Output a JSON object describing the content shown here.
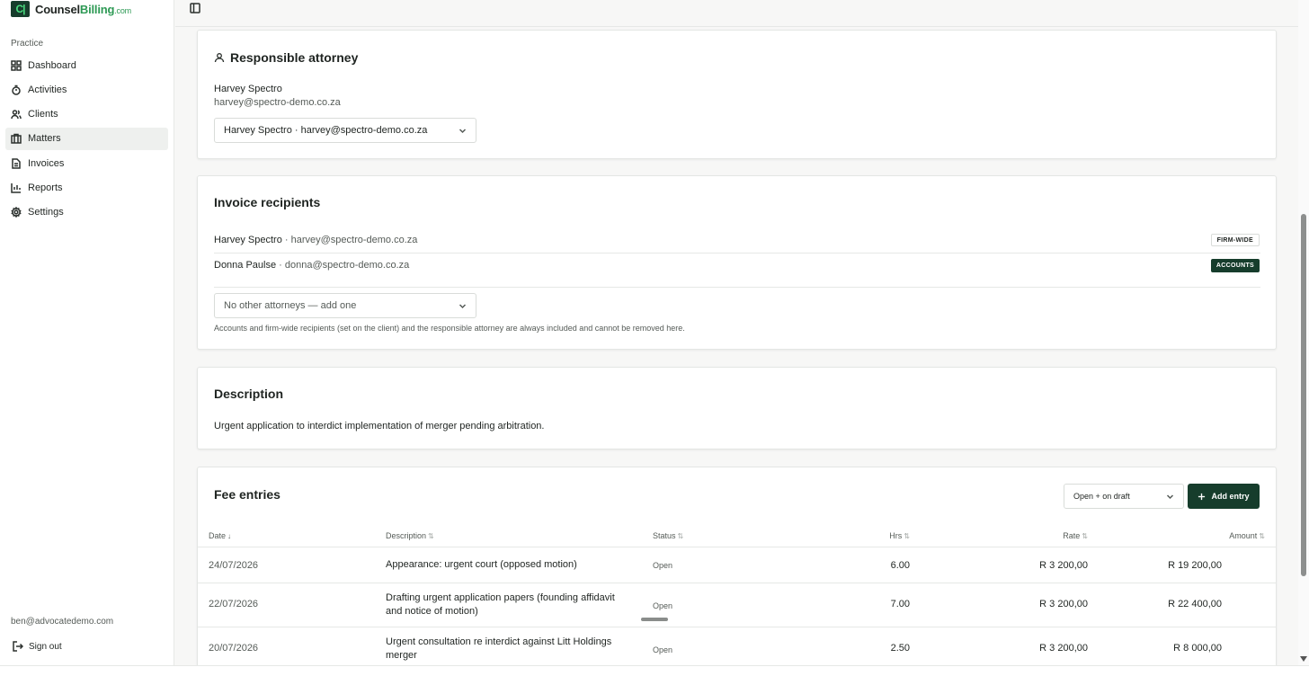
{
  "brand": {
    "logo_mark": "C|",
    "name_part1": "Counsel",
    "name_part2": "Billing",
    "name_part3": ".com"
  },
  "sidebar": {
    "section_label": "Practice",
    "items": [
      {
        "label": "Dashboard",
        "icon": "grid-icon"
      },
      {
        "label": "Activities",
        "icon": "timer-icon"
      },
      {
        "label": "Clients",
        "icon": "users-icon"
      },
      {
        "label": "Matters",
        "icon": "briefcase-icon",
        "active": true
      },
      {
        "label": "Invoices",
        "icon": "file-icon"
      },
      {
        "label": "Reports",
        "icon": "bar-chart-icon"
      },
      {
        "label": "Settings",
        "icon": "gear-icon"
      }
    ],
    "user_email": "ben@advocatedemo.com",
    "sign_out": "Sign out"
  },
  "responsible_attorney": {
    "title": "Responsible attorney",
    "name": "Harvey Spectro",
    "email": "harvey@spectro-demo.co.za",
    "select_value": "Harvey Spectro · harvey@spectro-demo.co.za"
  },
  "invoice_recipients": {
    "title": "Invoice recipients",
    "recipients": [
      {
        "name": "Harvey Spectro",
        "sep": " · ",
        "email": "harvey@spectro-demo.co.za",
        "badge": "FIRM-WIDE"
      },
      {
        "name": "Donna Paulse",
        "sep": " · ",
        "email": "donna@spectro-demo.co.za",
        "badge": "ACCOUNTS"
      }
    ],
    "select_placeholder": "No other attorneys — add one",
    "note": "Accounts and firm-wide recipients (set on the client) and the responsible attorney are always included and cannot be removed here."
  },
  "description": {
    "title": "Description",
    "text": "Urgent application to interdict implementation of merger pending arbitration."
  },
  "fee_entries": {
    "title": "Fee entries",
    "filter_value": "Open + on draft",
    "add_label": "Add entry",
    "columns": {
      "date": "Date",
      "description": "Description",
      "status": "Status",
      "hrs": "Hrs",
      "rate": "Rate",
      "amount": "Amount"
    },
    "sort_desc_glyph": "↓",
    "sort_glyph": "⇅",
    "rows": [
      {
        "date": "24/07/2026",
        "description_1": "Appearance: urgent court (opposed motion)",
        "description_2": "",
        "status": "Open",
        "hrs": "6.00",
        "rate": "R 3 200,00",
        "amount": "R 19 200,00"
      },
      {
        "date": "22/07/2026",
        "description_1": "Drafting urgent application papers (founding affidavit",
        "description_2": "and notice of motion)",
        "status": "Open",
        "hrs": "7.00",
        "rate": "R 3 200,00",
        "amount": "R 22 400,00"
      },
      {
        "date": "20/07/2026",
        "description_1": "Urgent consultation re interdict against Litt Holdings",
        "description_2": "merger",
        "status": "Open",
        "hrs": "2.50",
        "rate": "R 3 200,00",
        "amount": "R 8 000,00"
      }
    ]
  }
}
